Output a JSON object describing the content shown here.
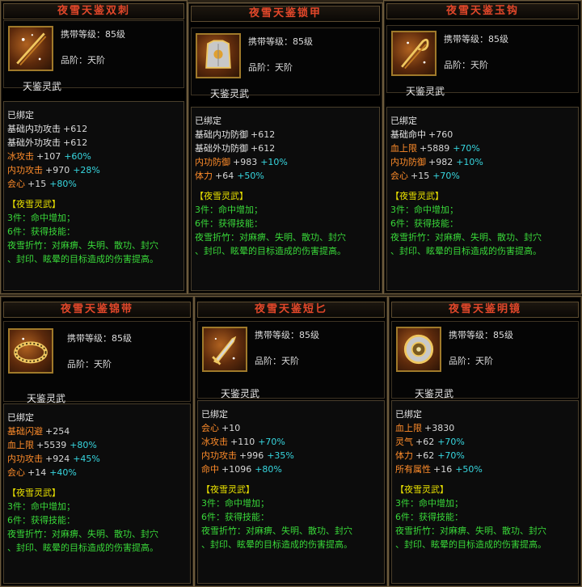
{
  "cards": [
    {
      "title": "夜雪天鉴双刺",
      "icon": "twin-daggers-icon",
      "req_label": "携带等级：85级",
      "grade_label": "品阶：天阶",
      "set_name": "天鉴灵武",
      "bound": "已绑定",
      "stats": [
        {
          "name": "基础内功攻击",
          "value": "+612",
          "bonus": "",
          "orange": false
        },
        {
          "name": "基础外功攻击",
          "value": "+612",
          "bonus": "",
          "orange": false
        },
        {
          "name": "冰攻击",
          "value": "+107",
          "bonus": "+60%",
          "orange": true
        },
        {
          "name": "内功攻击",
          "value": "+970",
          "bonus": "+28%",
          "orange": true
        },
        {
          "name": "会心",
          "value": "+15",
          "bonus": "+80%",
          "orange": true
        }
      ],
      "set_header": "【夜雪灵武】",
      "set_lines": [
        "3件：命中增加；",
        "6件：获得技能：",
        "夜雪折竹：对麻痹、失明、散功、封穴",
        "、封印、眩晕的目标造成的伤害提高。"
      ]
    },
    {
      "title": "夜雪天鉴锁甲",
      "icon": "chest-armor-icon",
      "req_label": "携带等级：85级",
      "grade_label": "品阶：天阶",
      "set_name": "天鉴灵武",
      "bound": "已绑定",
      "stats": [
        {
          "name": "基础内功防御",
          "value": "+612",
          "bonus": "",
          "orange": false
        },
        {
          "name": "基础外功防御",
          "value": "+612",
          "bonus": "",
          "orange": false
        },
        {
          "name": "内功防御",
          "value": "+983",
          "bonus": "+10%",
          "orange": true
        },
        {
          "name": "体力",
          "value": "+64",
          "bonus": "+50%",
          "orange": true
        }
      ],
      "set_header": "【夜雪灵武】",
      "set_lines": [
        "3件：命中增加；",
        "6件：获得技能：",
        "夜雪折竹：对麻痹、失明、散功、封穴",
        "、封印、眩晕的目标造成的伤害提高。"
      ]
    },
    {
      "title": "夜雪天鉴玉钩",
      "icon": "jade-hook-icon",
      "req_label": "携带等级：85级",
      "grade_label": "品阶：天阶",
      "set_name": "天鉴灵武",
      "bound": "已绑定",
      "stats": [
        {
          "name": "基础命中",
          "value": "+760",
          "bonus": "",
          "orange": false
        },
        {
          "name": "血上限",
          "value": "+5889",
          "bonus": "+70%",
          "orange": true
        },
        {
          "name": "内功防御",
          "value": "+982",
          "bonus": "+10%",
          "orange": true
        },
        {
          "name": "会心",
          "value": "+15",
          "bonus": "+70%",
          "orange": true
        }
      ],
      "set_header": "【夜雪灵武】",
      "set_lines": [
        "3件：命中增加；",
        "6件：获得技能：",
        "夜雪折竹：对麻痹、失明、散功、封穴",
        "、封印、眩晕的目标造成的伤害提高。"
      ]
    },
    {
      "title": "夜雪天鉴锦带",
      "icon": "belt-icon",
      "req_label": "携带等级：85级",
      "grade_label": "品阶：天阶",
      "set_name": "天鉴灵武",
      "bound": "已绑定",
      "stats": [
        {
          "name": "基础闪避",
          "value": "+254",
          "bonus": "",
          "orange": false
        },
        {
          "name": "血上限",
          "value": "+5539",
          "bonus": "+80%",
          "orange": true
        },
        {
          "name": "内功攻击",
          "value": "+924",
          "bonus": "+45%",
          "orange": true
        },
        {
          "name": "会心",
          "value": "+14",
          "bonus": "+40%",
          "orange": true
        }
      ],
      "set_header": "【夜雪灵武】",
      "set_lines": [
        "3件：命中增加；",
        "6件：获得技能：",
        "夜雪折竹：对麻痹、失明、散功、封穴",
        "、封印、眩晕的目标造成的伤害提高。"
      ]
    },
    {
      "title": "夜雪天鉴短匕",
      "icon": "short-dagger-icon",
      "req_label": "携带等级：85级",
      "grade_label": "品阶：天阶",
      "set_name": "天鉴灵武",
      "bound": "已绑定",
      "stats": [
        {
          "name": "会心",
          "value": "+10",
          "bonus": "",
          "orange": false
        },
        {
          "name": "冰攻击",
          "value": "+110",
          "bonus": "+70%",
          "orange": true
        },
        {
          "name": "内功攻击",
          "value": "+996",
          "bonus": "+35%",
          "orange": true
        },
        {
          "name": "命中",
          "value": "+1096",
          "bonus": "+80%",
          "orange": true
        }
      ],
      "set_header": "【夜雪灵武】",
      "set_lines": [
        "3件：命中增加；",
        "6件：获得技能：",
        "夜雪折竹：对麻痹、失明、散功、封穴",
        "、封印、眩晕的目标造成的伤害提高。"
      ]
    },
    {
      "title": "夜雪天鉴明镜",
      "icon": "bright-mirror-icon",
      "req_label": "携带等级：85级",
      "grade_label": "品阶：天阶",
      "set_name": "天鉴灵武",
      "bound": "已绑定",
      "stats": [
        {
          "name": "血上限",
          "value": "+3830",
          "bonus": "",
          "orange": false
        },
        {
          "name": "灵气",
          "value": "+62",
          "bonus": "+70%",
          "orange": true
        },
        {
          "name": "体力",
          "value": "+62",
          "bonus": "+70%",
          "orange": true
        },
        {
          "name": "所有属性",
          "value": "+16",
          "bonus": "+50%",
          "orange": true
        }
      ],
      "set_header": "【夜雪灵武】",
      "set_lines": [
        "3件：命中增加；",
        "6件：获得技能：",
        "夜雪折竹：对麻痹、失明、散功、封穴",
        "、封印、眩晕的目标造成的伤害提高。"
      ]
    }
  ]
}
